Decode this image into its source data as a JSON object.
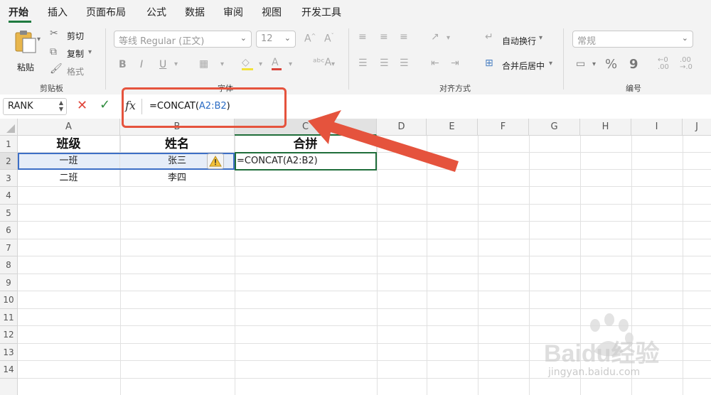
{
  "menu": {
    "tabs": [
      "开始",
      "插入",
      "页面布局",
      "公式",
      "数据",
      "审阅",
      "视图",
      "开发工具"
    ],
    "active_tab": "开始",
    "accent_color": "#1f7a3f"
  },
  "ribbon": {
    "clipboard": {
      "paste_label": "粘贴",
      "cut_label": "剪切",
      "copy_label": "复制",
      "format_label": "格式",
      "group_label": "剪贴板"
    },
    "font": {
      "font_name": "等线 Regular (正文)",
      "font_size": "12",
      "bold": "B",
      "italic": "I",
      "underline": "U",
      "group_label": "字体"
    },
    "alignment": {
      "wrap_label": "自动换行",
      "merge_label": "合并后居中",
      "group_label": "对齐方式"
    },
    "number": {
      "format": "常规",
      "percent": "%",
      "comma": "9",
      "group_label": "编号"
    }
  },
  "formula_bar": {
    "name_box": "RANK",
    "fx": "fx",
    "formula_prefix": "=CONCAT(",
    "formula_ref": "A2:B2",
    "formula_suffix": ")"
  },
  "sheet": {
    "columns": [
      "A",
      "B",
      "C",
      "D",
      "E",
      "F",
      "G",
      "H",
      "I",
      "J"
    ],
    "rows": [
      "1",
      "2",
      "3",
      "4",
      "5",
      "6",
      "7",
      "8",
      "9",
      "10",
      "11",
      "12",
      "13",
      "14"
    ],
    "cells": {
      "A1": "班级",
      "B1": "姓名",
      "C1": "合拼",
      "A2": "一班",
      "B2": "张三",
      "C2": "=CONCAT(A2:B2)",
      "A3": "二班",
      "B3": "李四"
    },
    "active_cell": "C2"
  },
  "annotations": {
    "highlight_color": "#e5533d"
  },
  "watermark": {
    "brand": "Baidu经验",
    "url": "jingyan.baidu.com"
  }
}
